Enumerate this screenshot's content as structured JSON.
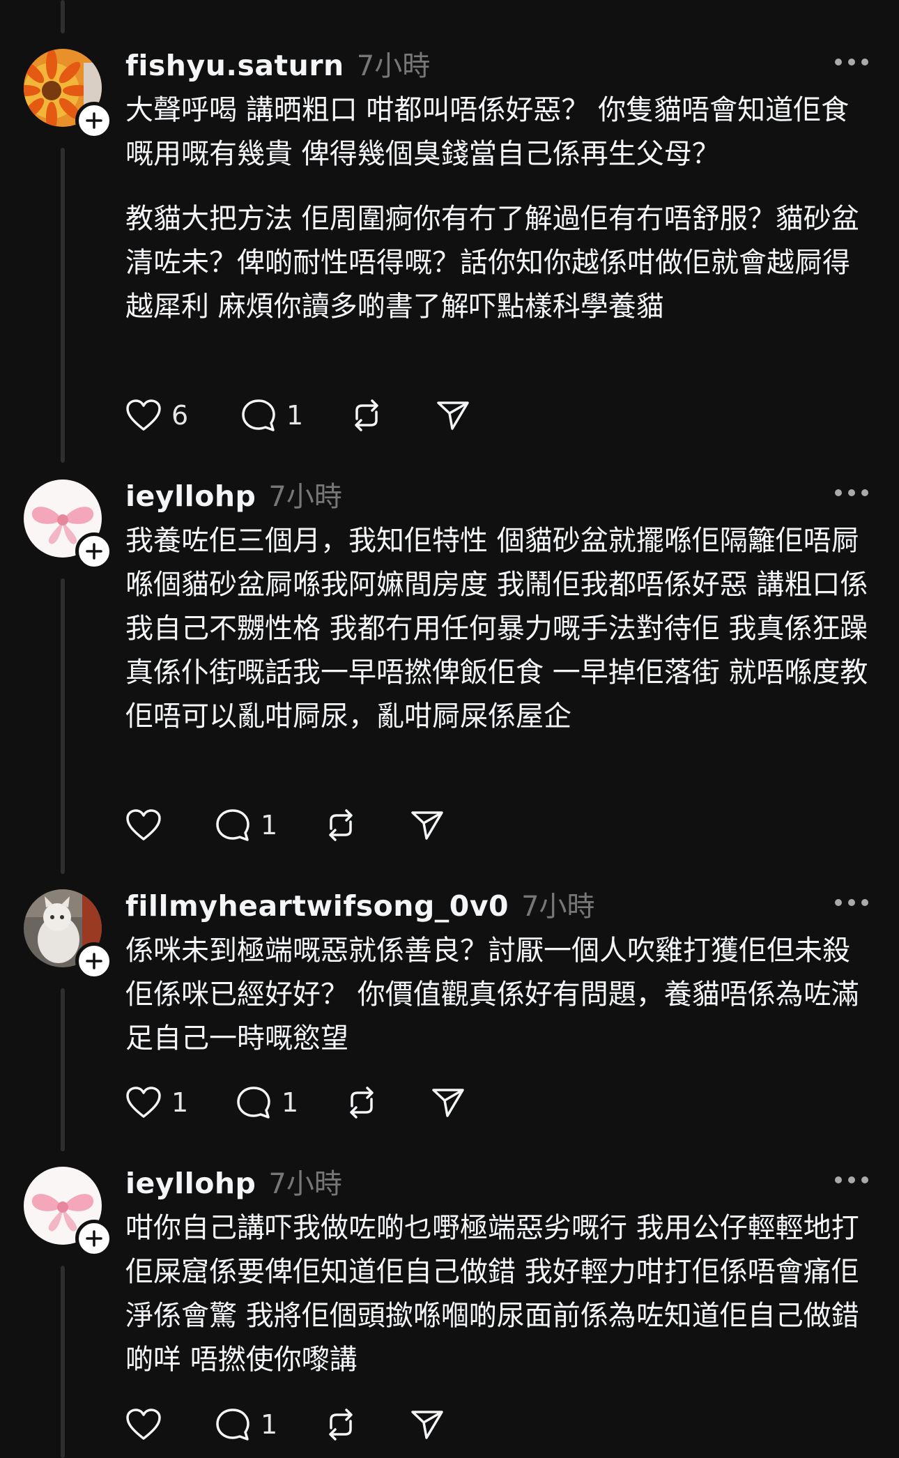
{
  "posts": [
    {
      "username": "fishyu.saturn",
      "time": "7小時",
      "paragraphs": [
        "大聲呼喝 講晒粗口 咁都叫唔係好惡？ 你隻貓唔會知道佢食嘅用嘅有幾貴 俾得幾個臭錢當自己係再生父母？",
        "教貓大把方法 佢周圍痾你有冇了解過佢有冇唔舒服？貓砂盆清咗未？俾啲耐性唔得嘅？話你知你越係咁做佢就會越屙得越犀利 麻煩你讀多啲書了解吓點樣科學養貓"
      ],
      "likes": "6",
      "replies": "1",
      "avatar_icon": "orange-flower-avatar"
    },
    {
      "username": "ieyllohp",
      "time": "7小時",
      "paragraphs": [
        "我養咗佢三個月，我知佢特性 個貓砂盆就擺喺佢隔籬佢唔屙喺個貓砂盆屙喺我阿嫲間房度 我鬧佢我都唔係好惡 講粗口係我自己不嬲性格 我都冇用任何暴力嘅手法對待佢 我真係狂躁真係仆街嘅話我一早唔撚俾飯佢食 一早掉佢落街 就唔喺度教佢唔可以亂咁屙尿，亂咁屙屎係屋企"
      ],
      "likes": "",
      "replies": "1",
      "avatar_icon": "pink-bow-avatar"
    },
    {
      "username": "fillmyheartwifsong_0v0",
      "time": "7小時",
      "paragraphs": [
        "係咪未到極端嘅惡就係善良？討厭一個人吹雞打獲佢但未殺佢係咪已經好好？ 你價值觀真係好有問題，養貓唔係為咗滿足自己一時嘅慾望"
      ],
      "likes": "1",
      "replies": "1",
      "avatar_icon": "cat-photo-avatar"
    },
    {
      "username": "ieyllohp",
      "time": "7小時",
      "paragraphs": [
        "咁你自己講吓我做咗啲乜嘢極端惡劣嘅行 我用公仔輕輕地打佢屎窟係要俾佢知道佢自己做錯 我好輕力咁打佢係唔會痛佢淨係會驚 我將佢個頭撳喺嗰啲尿面前係為咗知道佢自己做錯啲咩 唔撚使你嚟講"
      ],
      "likes": "",
      "replies": "1",
      "avatar_icon": "pink-bow-avatar"
    }
  ],
  "icons": {
    "like": "heart-icon",
    "reply": "comment-icon",
    "repost": "repost-icon",
    "share": "share-icon",
    "more": "more-dots-icon",
    "follow": "plus-icon"
  }
}
